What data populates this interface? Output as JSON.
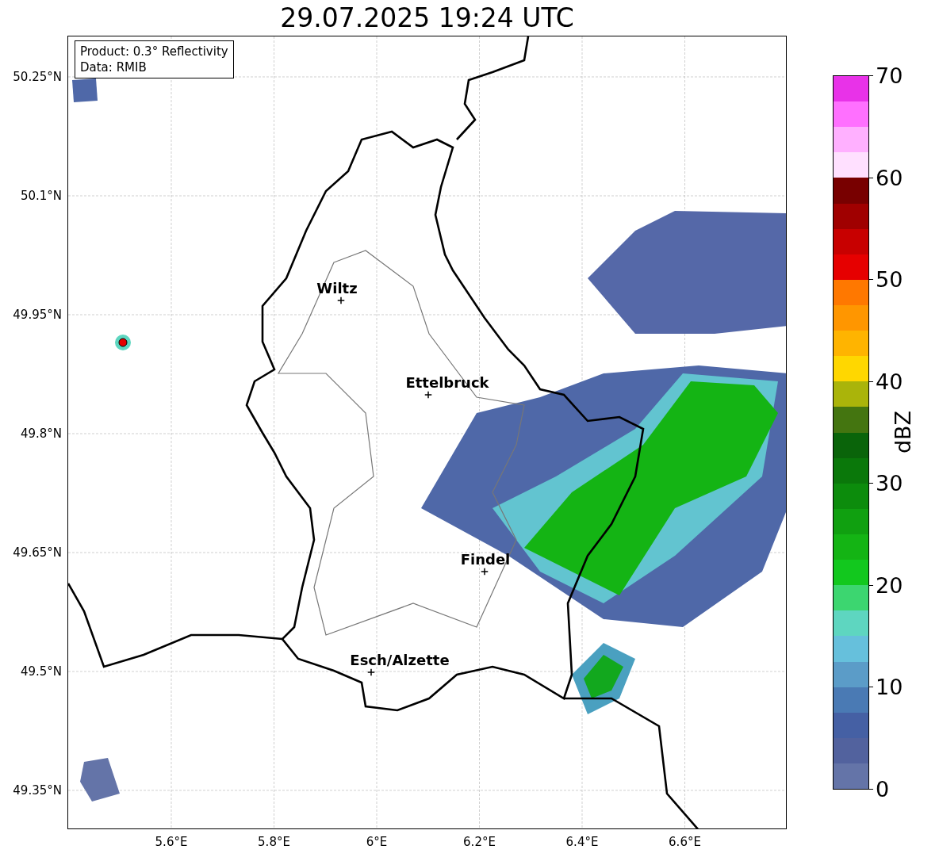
{
  "title": "29.07.2025 19:24 UTC",
  "info_box": [
    "Product: 0.3° Reflectivity",
    "Data: RMIB"
  ],
  "map": {
    "cities": [
      {
        "name": "Wiltz"
      },
      {
        "name": "Ettelbruck"
      },
      {
        "name": "Findel"
      },
      {
        "name": "Esch/Alzette"
      }
    ],
    "lat_ticks": [
      "50.25°N",
      "50.1°N",
      "49.95°N",
      "49.8°N",
      "49.65°N",
      "49.5°N",
      "49.35°N"
    ],
    "lon_ticks": [
      "5.6°E",
      "5.8°E",
      "6°E",
      "6.2°E",
      "6.4°E",
      "6.6°E"
    ]
  },
  "colorbar": {
    "label": "dBZ",
    "ticks": [
      "70",
      "60",
      "50",
      "40",
      "30",
      "20",
      "10",
      "0"
    ],
    "bins": [
      {
        "color": "#e832e8"
      },
      {
        "color": "#ff70ff"
      },
      {
        "color": "#ffb0ff"
      },
      {
        "color": "#ffe0ff"
      },
      {
        "color": "#780000"
      },
      {
        "color": "#a00000"
      },
      {
        "color": "#c80000"
      },
      {
        "color": "#e60000"
      },
      {
        "color": "#ff7800"
      },
      {
        "color": "#ff9600"
      },
      {
        "color": "#ffb400"
      },
      {
        "color": "#ffd700"
      },
      {
        "color": "#aab40a"
      },
      {
        "color": "#447510"
      },
      {
        "color": "#0a640a"
      },
      {
        "color": "#0a780a"
      },
      {
        "color": "#0c8c0c"
      },
      {
        "color": "#10a010"
      },
      {
        "color": "#14b414"
      },
      {
        "color": "#12c81e"
      },
      {
        "color": "#3cd670"
      },
      {
        "color": "#5ed6c0"
      },
      {
        "color": "#66c0dc"
      },
      {
        "color": "#5b9cc8"
      },
      {
        "color": "#4a7ab4"
      },
      {
        "color": "#4560a4"
      },
      {
        "color": "#52629e"
      },
      {
        "color": "#6474a8"
      }
    ]
  }
}
